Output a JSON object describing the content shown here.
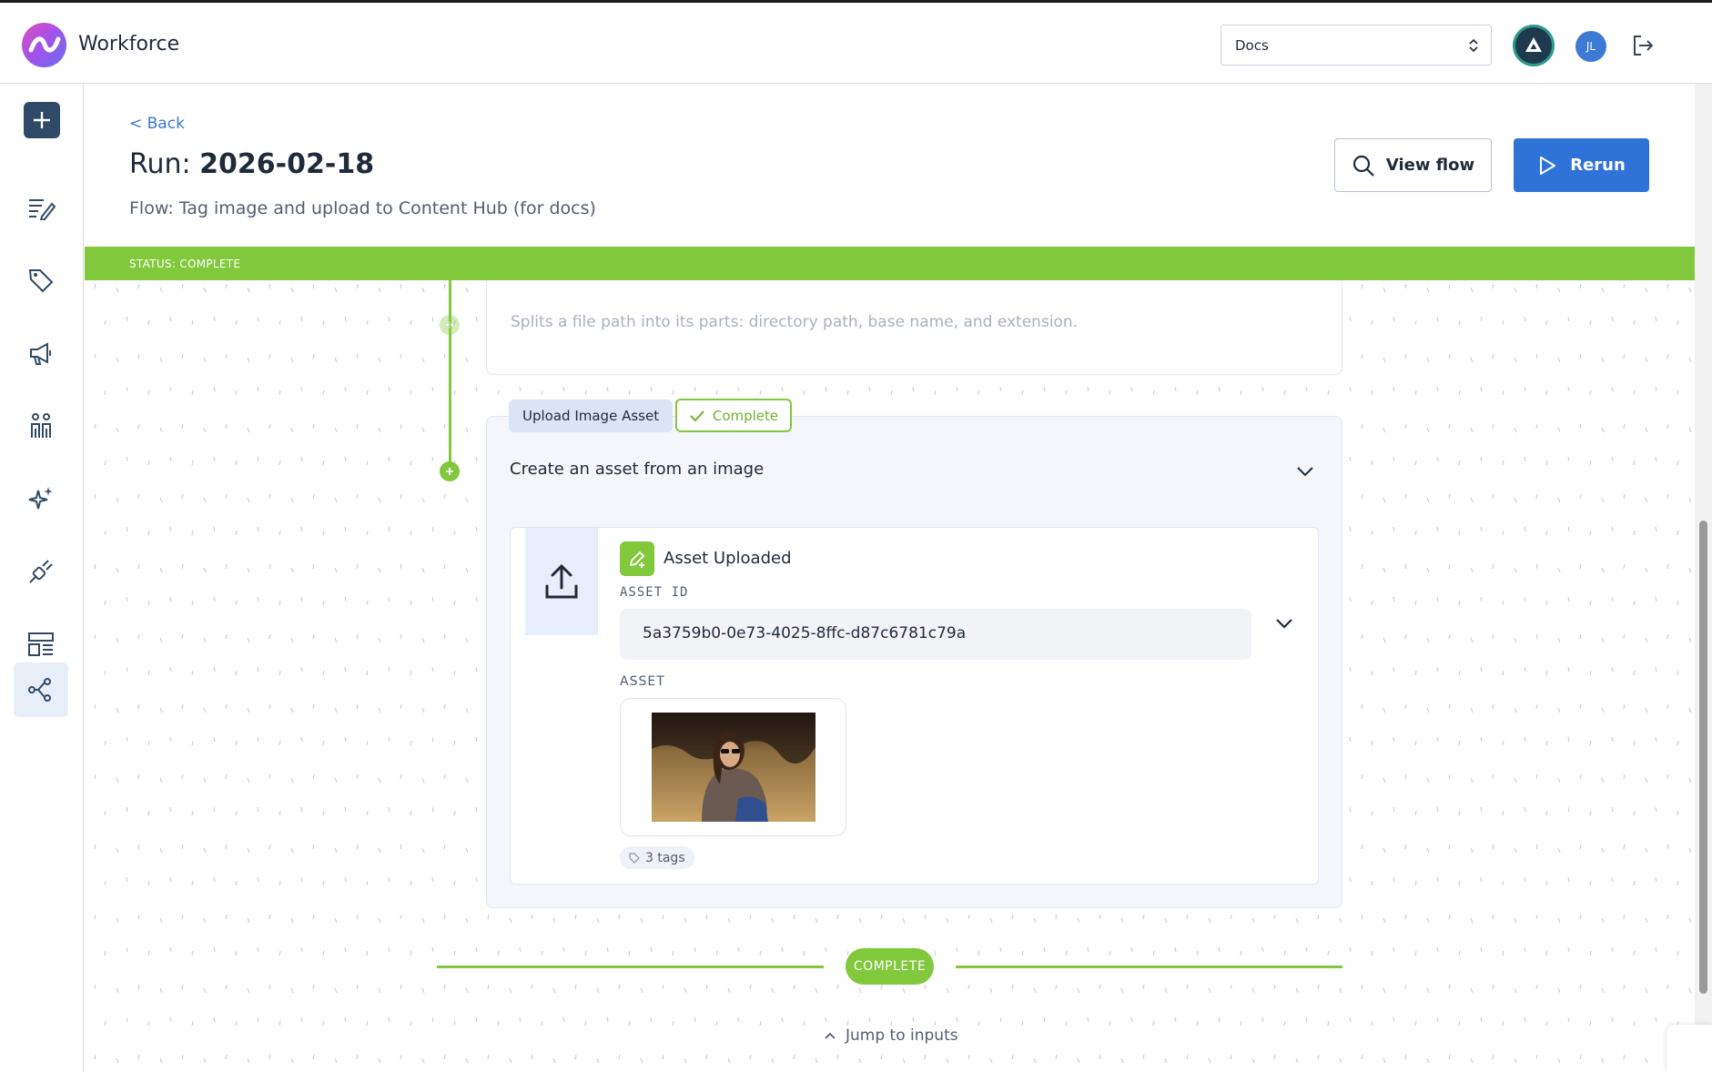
{
  "app": {
    "title": "Workforce"
  },
  "header": {
    "space_select": "Docs",
    "avatar_initials": "JL"
  },
  "page": {
    "back_label": "< Back",
    "title_prefix": "Run: ",
    "title_value": "2026-02-18",
    "flow_subtitle": "Flow: Tag image and upload to Content Hub (for docs)",
    "view_flow_label": "View flow",
    "rerun_label": "Rerun",
    "status_text": "STATUS: COMPLETE"
  },
  "steps": {
    "previous_description": "Splits a file path into its parts: directory path, base name, and extension.",
    "current": {
      "name": "Upload Image Asset",
      "status": "Complete",
      "description": "Create an asset from an image",
      "result": {
        "title": "Asset Uploaded",
        "asset_id_label": "ASSET ID",
        "asset_id": "5a3759b0-0e73-4025-8ffc-d87c6781c79a",
        "asset_label": "ASSET",
        "tags": "3 tags"
      }
    }
  },
  "footer": {
    "end_status": "COMPLETE",
    "jump_label": "Jump to inputs"
  },
  "colors": {
    "accent_green": "#82c83c",
    "primary_blue": "#2f73d9",
    "sidebar_dark": "#2e4a66"
  }
}
